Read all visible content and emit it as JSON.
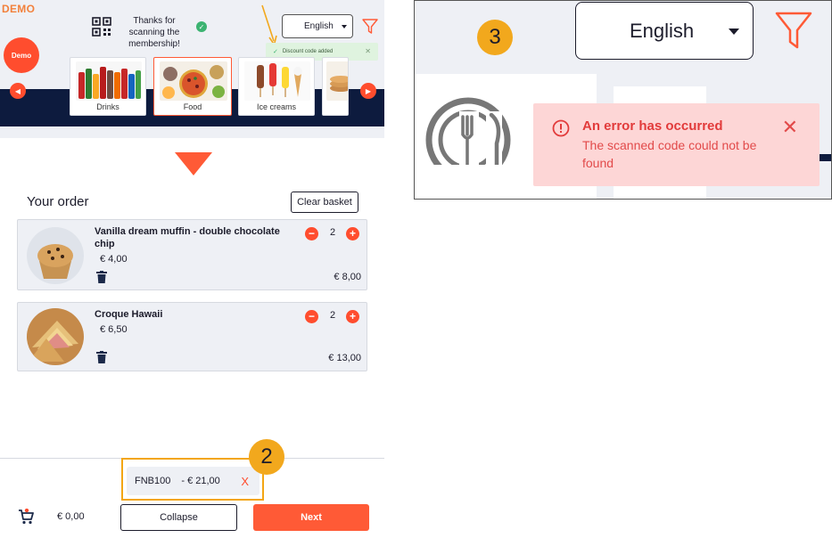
{
  "brand": {
    "demo_label": "DEMO",
    "demo_badge": "Demo"
  },
  "header": {
    "scan_message": "Thanks for scanning the membership!",
    "language": "English",
    "toast": "Discount code added"
  },
  "categories": [
    {
      "label": "Drinks",
      "selected": false
    },
    {
      "label": "Food",
      "selected": true
    },
    {
      "label": "Ice creams",
      "selected": false
    }
  ],
  "order": {
    "title": "Your order",
    "clear_label": "Clear basket",
    "items": [
      {
        "name": "Vanilla dream muffin - double chocolate chip",
        "unit_price": "€ 4,00",
        "qty": "2",
        "total": "€ 8,00"
      },
      {
        "name": "Croque Hawaii",
        "unit_price": "€ 6,50",
        "qty": "2",
        "total": "€ 13,00"
      }
    ]
  },
  "coupon": {
    "code": "FNB100",
    "discount": "- € 21,00",
    "remove": "X"
  },
  "footer": {
    "cart_total": "€ 0,00",
    "collapse_label": "Collapse",
    "next_label": "Next"
  },
  "annotations": {
    "badge2": "2",
    "badge3": "3"
  },
  "zoom": {
    "language": "English",
    "error_title": "An error has occurred",
    "error_message": "The scanned code could not be found"
  },
  "colors": {
    "accent": "#ff5a36",
    "navy": "#0d1b3e",
    "highlight": "#f2a81d",
    "error_bg": "#fdd6d6",
    "error_text": "#e23b3b"
  }
}
